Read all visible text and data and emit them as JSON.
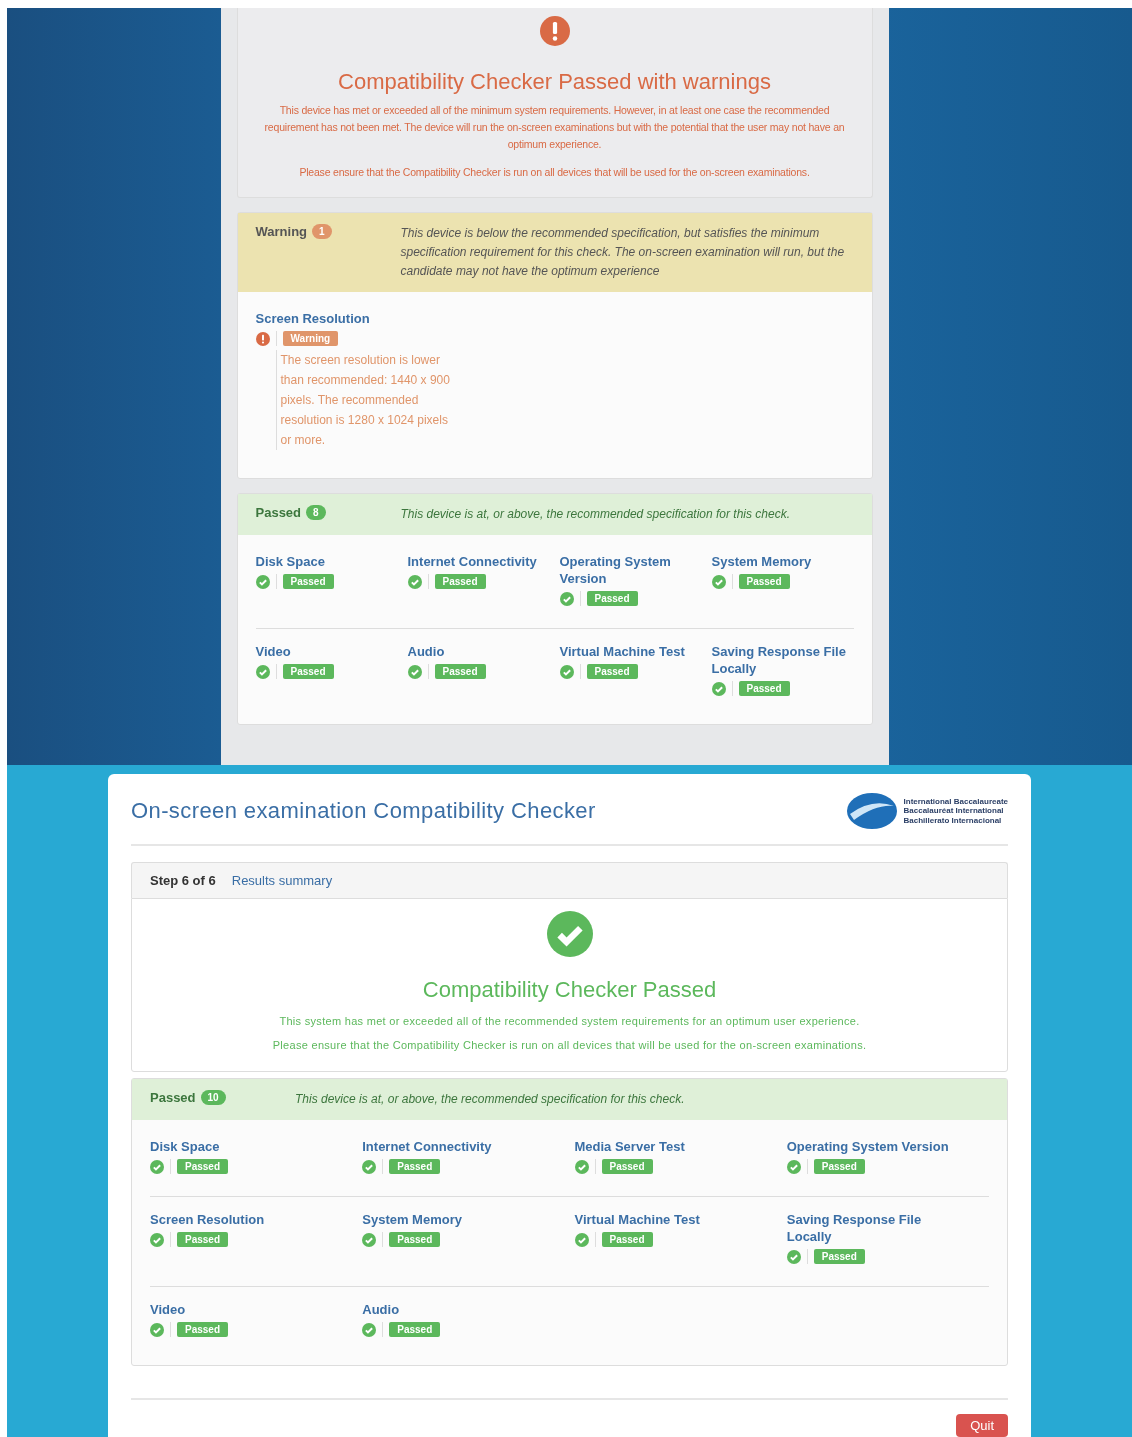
{
  "photo_screen": {
    "result": {
      "kind": "warning",
      "title": "Compatibility Checker Passed with warnings",
      "paragraphs": [
        "This device has met or exceeded all of the minimum system requirements. However, in at least one case the recommended requirement has not been met. The device will run the on-screen examinations but with the potential that the user may not have an optimum experience.",
        "Please ensure that the Compatibility Checker is run on all devices that will be used for the on-screen examinations."
      ]
    },
    "groups": [
      {
        "kind": "warning",
        "label": "Warning",
        "count": "1",
        "description": "This device is below the recommended specification, but satisfies the minimum specification requirement for this check. The on-screen examination will run, but the candidate may not have the optimum experience",
        "items": [
          {
            "name": "Screen Resolution",
            "kind": "warning",
            "badge": "Warning",
            "message": "The screen resolution is lower than recommended: 1440 x 900 pixels. The recommended resolution is 1280 x 1024 pixels or more."
          }
        ]
      },
      {
        "kind": "passed",
        "label": "Passed",
        "count": "8",
        "description": "This device is at, or above, the recommended specification for this check.",
        "items": [
          {
            "name": "Disk Space",
            "kind": "passed",
            "badge": "Passed"
          },
          {
            "name": "Internet Connectivity",
            "kind": "passed",
            "badge": "Passed"
          },
          {
            "name": "Operating System Version",
            "kind": "passed",
            "badge": "Passed"
          },
          {
            "name": "System Memory",
            "kind": "passed",
            "badge": "Passed"
          },
          {
            "name": "Video",
            "kind": "passed",
            "badge": "Passed"
          },
          {
            "name": "Audio",
            "kind": "passed",
            "badge": "Passed"
          },
          {
            "name": "Virtual Machine Test",
            "kind": "passed",
            "badge": "Passed"
          },
          {
            "name": "Saving Response File Locally",
            "kind": "passed",
            "badge": "Passed"
          }
        ]
      }
    ]
  },
  "screenshot": {
    "header": {
      "title": "On-screen examination Compatibility Checker",
      "logo_lines": [
        "International Baccalaureate",
        "Baccalauréat International",
        "Bachillerato Internacional"
      ]
    },
    "step": {
      "label": "Step 6 of 6",
      "title": "Results summary"
    },
    "result": {
      "kind": "passed",
      "title": "Compatibility Checker Passed",
      "paragraphs": [
        "This system has met or exceeded all of the recommended system requirements for an optimum user experience.",
        "Please ensure that the Compatibility Checker is run on all devices that will be used for the on-screen examinations."
      ]
    },
    "groups": [
      {
        "kind": "passed",
        "label": "Passed",
        "count": "10",
        "description": "This device is at, or above, the recommended specification for this check.",
        "items": [
          {
            "name": "Disk Space",
            "kind": "passed",
            "badge": "Passed"
          },
          {
            "name": "Internet Connectivity",
            "kind": "passed",
            "badge": "Passed"
          },
          {
            "name": "Media Server Test",
            "kind": "passed",
            "badge": "Passed"
          },
          {
            "name": "Operating System Version",
            "kind": "passed",
            "badge": "Passed"
          },
          {
            "name": "Screen Resolution",
            "kind": "passed",
            "badge": "Passed"
          },
          {
            "name": "System Memory",
            "kind": "passed",
            "badge": "Passed"
          },
          {
            "name": "Virtual Machine Test",
            "kind": "passed",
            "badge": "Passed"
          },
          {
            "name": "Saving Response File Locally",
            "kind": "passed",
            "badge": "Passed"
          },
          {
            "name": "Video",
            "kind": "passed",
            "badge": "Passed"
          },
          {
            "name": "Audio",
            "kind": "passed",
            "badge": "Passed"
          }
        ]
      }
    ],
    "quit_button": "Quit"
  }
}
